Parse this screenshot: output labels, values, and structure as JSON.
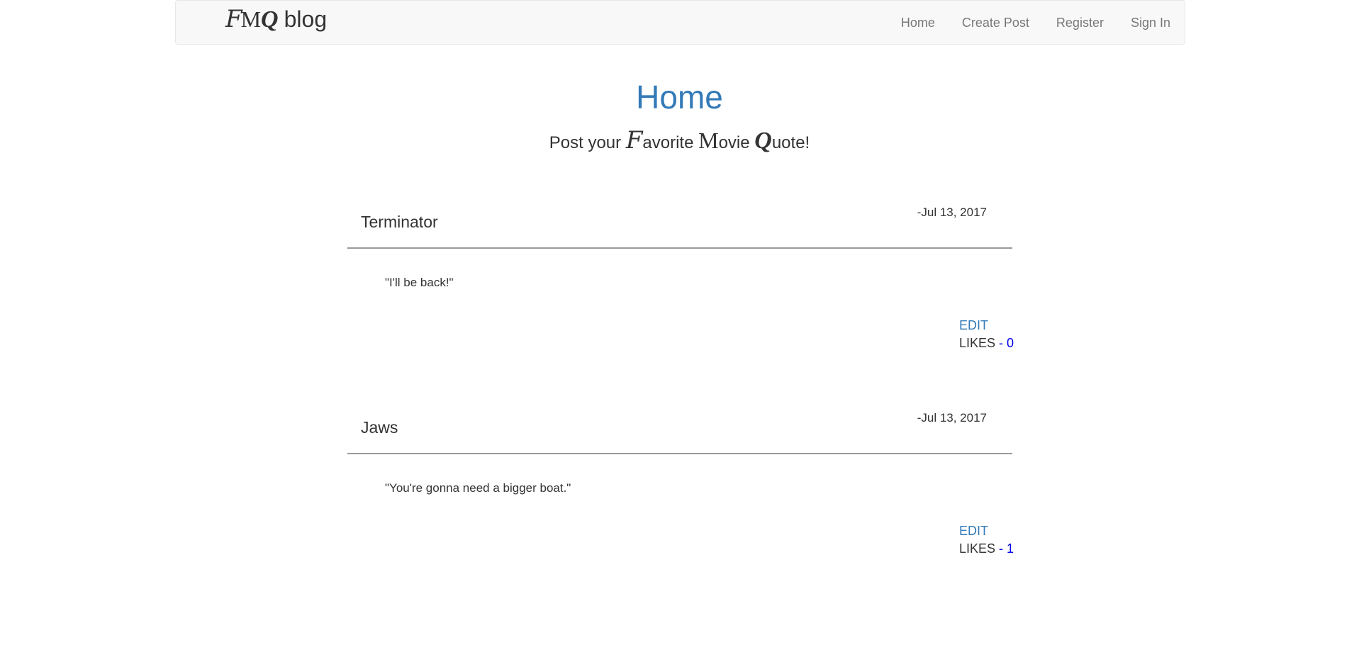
{
  "navbar": {
    "brand": {
      "letter_f": "F",
      "letter_m": "M",
      "letter_q": "Q",
      "rest": "blog"
    },
    "links": [
      "Home",
      "Create Post",
      "Register",
      "Sign In"
    ]
  },
  "hero": {
    "title": "Home",
    "subtitle_prefix": "Post your ",
    "f": "F",
    "avorite": "avorite ",
    "m": "M",
    "ovie": "ovie ",
    "q": "Q",
    "uote": "uote!"
  },
  "posts": [
    {
      "title": "Terminator",
      "date": "-Jul 13, 2017",
      "quote": "\"I'll be back!\"",
      "edit_label": "EDIT",
      "likes_label": "LIKES",
      "likes_sep": " - ",
      "likes_count": "0"
    },
    {
      "title": "Jaws",
      "date": "-Jul 13, 2017",
      "quote": "\"You're gonna need a bigger boat.\"",
      "edit_label": "EDIT",
      "likes_label": "LIKES",
      "likes_sep": " - ",
      "likes_count": "1"
    }
  ],
  "colors": {
    "accent": "#337ab7",
    "likes_count": "#0000ee",
    "navbar_bg": "#f8f8f8"
  }
}
